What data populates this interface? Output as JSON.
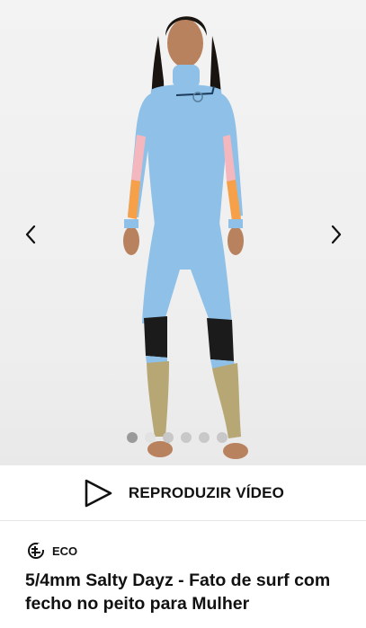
{
  "gallery": {
    "image_alt": "Mulher a vestir fato de surf azul claro com detalhes rosa, laranja e caqui",
    "slide_count": 6,
    "active_index": 0
  },
  "video": {
    "label": "REPRODUZIR VÍDEO"
  },
  "badge": {
    "label": "ECO"
  },
  "product": {
    "title": "5/4mm Salty Dayz - Fato de surf com fecho no peito para Mulher"
  },
  "colors": {
    "suit_blue": "#8ec0e8",
    "accent_pink": "#f3b7bd",
    "accent_orange": "#f6a04a",
    "leg_khaki": "#b7a774",
    "knee_black": "#1b1b1b"
  },
  "icons": {
    "prev": "chevron-left-icon",
    "next": "chevron-right-icon",
    "play": "play-icon",
    "eco": "eco-icon"
  }
}
